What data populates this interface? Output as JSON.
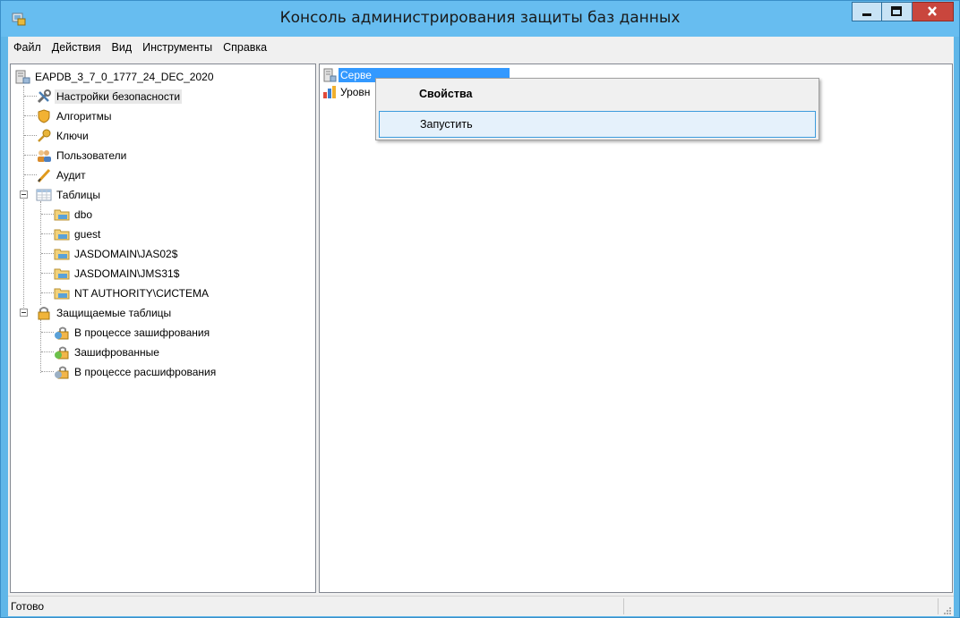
{
  "window": {
    "title": "Консоль администрирования защиты баз данных"
  },
  "menubar": [
    "Файл",
    "Действия",
    "Вид",
    "Инструменты",
    "Справка"
  ],
  "tree": {
    "root": "EAPDB_3_7_0_1777_24_DEC_2020",
    "security_settings": "Настройки безопасности",
    "algorithms": "Алгоритмы",
    "keys": "Ключи",
    "users": "Пользователи",
    "audit": "Аудит",
    "tables": "Таблицы",
    "schemas": [
      "dbo",
      "guest",
      "JASDOMAIN\\JAS02$",
      "JASDOMAIN\\JMS31$",
      "NT AUTHORITY\\СИСТЕМА"
    ],
    "protected_tables": "Защищаемые таблицы",
    "protected_children": [
      "В процессе зашифрования",
      "Зашифрованные",
      "В процессе расшифрования"
    ]
  },
  "list": {
    "items": [
      "Серве",
      "Уровн"
    ]
  },
  "context_menu": {
    "properties": "Свойства",
    "start": "Запустить"
  },
  "status": {
    "text": "Готово"
  }
}
